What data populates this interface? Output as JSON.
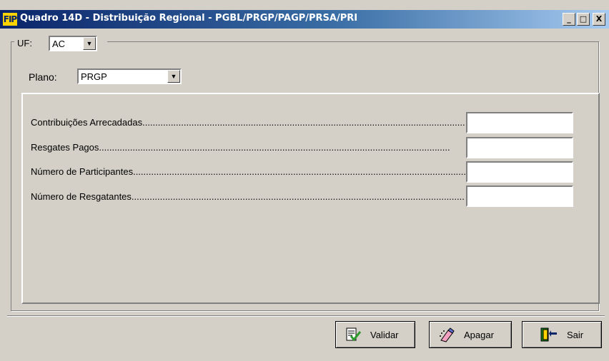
{
  "window": {
    "title": "Quadro 14D - Distribuição Regional - PGBL/PRGP/PAGP/PRSA/PRI",
    "app_icon_text": "FIP",
    "controls": {
      "minimize": "_",
      "maximize": "□",
      "close": "X"
    }
  },
  "uf": {
    "label": "UF:",
    "value": "AC",
    "arrow": "▼"
  },
  "plano": {
    "label": "Plano:",
    "value": "PRGP",
    "arrow": "▼"
  },
  "fields": [
    {
      "label": "Contribuições Arrecadadas",
      "value": ""
    },
    {
      "label": "Resgates Pagos",
      "value": ""
    },
    {
      "label": "Número de Participantes",
      "value": ""
    },
    {
      "label": "Número de Resgatantes",
      "value": ""
    }
  ],
  "buttons": {
    "validar": "Validar",
    "apagar": "Apagar",
    "sair": "Sair"
  },
  "icons": {
    "app": "fip-logo-icon",
    "validar": "checklist-icon",
    "apagar": "eraser-icon",
    "sair": "exit-door-icon"
  },
  "colors": {
    "face": "#d4d0c8",
    "title_start": "#0a246a",
    "title_end": "#a6caf0",
    "icon_green": "#2e9b2e",
    "door": "#1a7f1a"
  }
}
